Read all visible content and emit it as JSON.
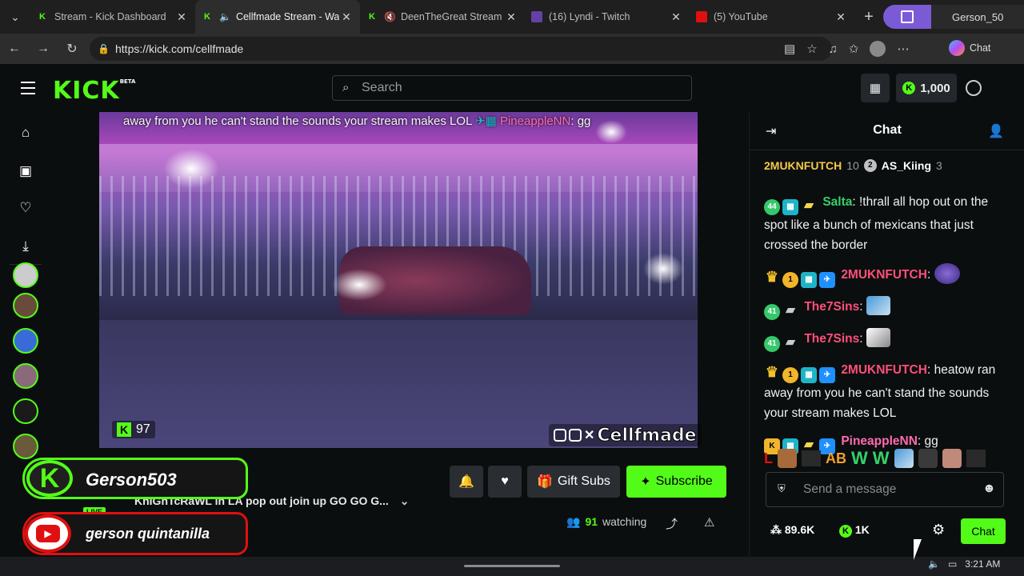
{
  "browser": {
    "tabs": [
      {
        "title": "Stream - Kick Dashboard",
        "icon": "kick-icon",
        "active": false,
        "muted": false
      },
      {
        "title": "Cellfmade Stream - Wa",
        "icon": "kick-icon",
        "active": true,
        "muted": false
      },
      {
        "title": "DeenTheGreat Stream",
        "icon": "kick-icon",
        "active": false,
        "muted": true
      },
      {
        "title": "(16) Lyndi - Twitch",
        "icon": "twitch-icon",
        "active": false,
        "muted": false
      },
      {
        "title": "(5) YouTube",
        "icon": "youtube-icon",
        "active": false,
        "muted": false
      }
    ],
    "profile_name": "Gerson_50",
    "url": "https://kick.com/cellfmade",
    "chat_label": "Chat"
  },
  "kick": {
    "logo": "KICK",
    "logo_tag": "BETA",
    "search_placeholder": "Search",
    "points_value": "1,000",
    "accent": "#53fc18"
  },
  "video": {
    "overlay_text": "away from you he can't stand the sounds your stream makes LOL",
    "overlay_name": "PineappleNN",
    "overlay_msg": "gg",
    "viewer_count": "97",
    "watermark": "Cellfmade"
  },
  "streamer": {
    "banner_name": "Gerson503",
    "youtube_name": "gerson quintanilla",
    "live_label": "LIVE",
    "title": "KnIGhTcRaWL in LA pop out join up GO GO G...",
    "gift_label": "Gift Subs",
    "subscribe_label": "Subscribe",
    "watching_count": "91",
    "watching_label": "watching"
  },
  "chat": {
    "title": "Chat",
    "pinned": [
      {
        "name": "2MUKNFUTCH",
        "count": "10"
      },
      {
        "name": "AS_Kiing",
        "count": "3"
      }
    ],
    "messages": [
      {
        "badge": "44",
        "name": "Salta",
        "color": "#35d06a",
        "text": "!thrall all hop out on the spot like a bunch of mexicans that just crossed the border"
      },
      {
        "badge": "1",
        "name": "2MUKNFUTCH",
        "color": "#ff4f7a",
        "text": ""
      },
      {
        "badge": "41",
        "name": "The7Sins",
        "color": "#ff4f7a",
        "text": ""
      },
      {
        "badge": "41",
        "name": "The7Sins",
        "color": "#ff4f7a",
        "text": ""
      },
      {
        "badge": "1",
        "name": "2MUKNFUTCH",
        "color": "#ff4f7a",
        "text": "heatow ran away from you he can't stand the sounds your stream makes LOL"
      },
      {
        "badge": "K",
        "name": "PineappleNN",
        "color": "#ff6ab0",
        "text": "gg"
      }
    ],
    "emote_bar": [
      "L",
      "AB",
      "W",
      "W"
    ],
    "input_placeholder": "Send a message",
    "followers": "89.6K",
    "points": "1K",
    "send_label": "Chat"
  },
  "system": {
    "time": "3:21 AM"
  }
}
